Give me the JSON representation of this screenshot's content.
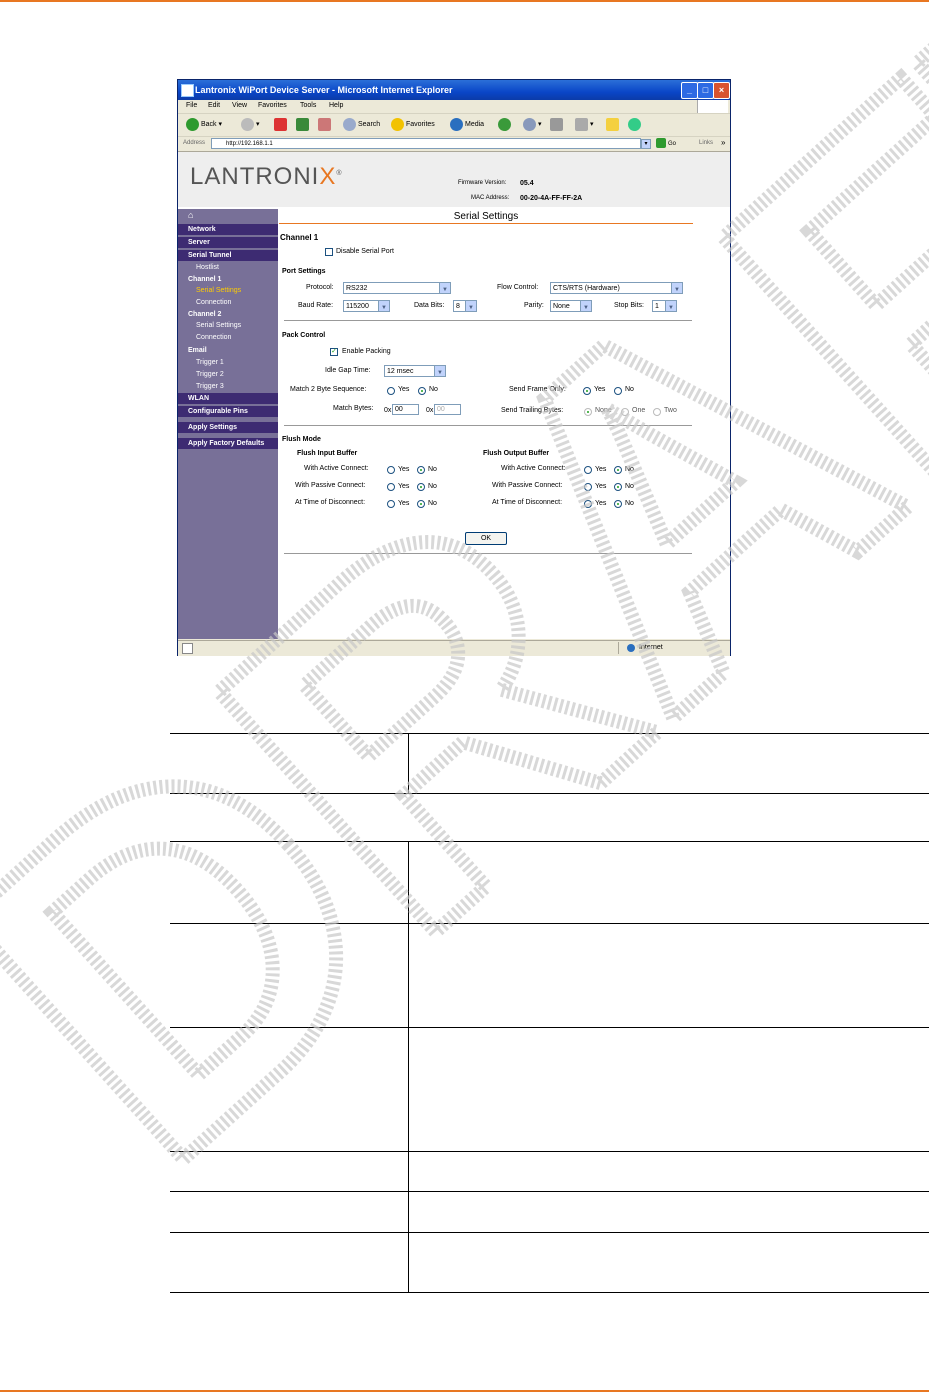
{
  "browser": {
    "title": "Lantronix WiPort Device Server - Microsoft Internet Explorer",
    "menu": [
      "File",
      "Edit",
      "View",
      "Favorites",
      "Tools",
      "Help"
    ],
    "toolbar": {
      "back": "Back",
      "search": "Search",
      "favorites": "Favorites",
      "media": "Media"
    },
    "address_label": "Address",
    "address_value": "http://192.168.1.1",
    "go": "Go",
    "links": "Links",
    "status_zone": "Internet"
  },
  "header": {
    "logo_text": "LANTRONI",
    "logo_x": "X",
    "logo_reg": "®",
    "firmware_label": "Firmware Version:",
    "firmware_value": "05.4",
    "mac_label": "MAC Address:",
    "mac_value": "00-20-4A-FF-FF-2A"
  },
  "sidebar": {
    "network": "Network",
    "server": "Server",
    "serial_tunnel": "Serial Tunnel",
    "hostlist": "Hostlist",
    "channel1": "Channel 1",
    "serial_settings1": "Serial Settings",
    "connection1": "Connection",
    "channel2": "Channel 2",
    "serial_settings2": "Serial Settings",
    "connection2": "Connection",
    "email": "Email",
    "trigger1": "Trigger 1",
    "trigger2": "Trigger 2",
    "trigger3": "Trigger 3",
    "wlan": "WLAN",
    "configurable_pins": "Configurable Pins",
    "apply_settings": "Apply Settings",
    "apply_factory": "Apply Factory Defaults"
  },
  "form": {
    "page_title": "Serial Settings",
    "channel_heading": "Channel 1",
    "disable_serial": "Disable Serial Port",
    "port_settings": "Port Settings",
    "protocol_label": "Protocol:",
    "protocol_value": "RS232",
    "flow_label": "Flow Control:",
    "flow_value": "CTS/RTS (Hardware)",
    "baud_label": "Baud Rate:",
    "baud_value": "115200",
    "databits_label": "Data Bits:",
    "databits_value": "8",
    "parity_label": "Parity:",
    "parity_value": "None",
    "stopbits_label": "Stop Bits:",
    "stopbits_value": "1",
    "pack_control": "Pack Control",
    "enable_packing": "Enable Packing",
    "idle_gap_label": "Idle Gap Time:",
    "idle_gap_value": "12 msec",
    "match2_label": "Match 2 Byte Sequence:",
    "send_frame_label": "Send Frame Only:",
    "match_bytes_label": "Match Bytes:",
    "hex_prefix": "0x",
    "match_byte1": "00",
    "match_byte2": "00",
    "send_trailing_label": "Send Trailing Bytes:",
    "none": "None",
    "one": "One",
    "two": "Two",
    "yes": "Yes",
    "no": "No",
    "flush_mode": "Flush Mode",
    "flush_input": "Flush Input Buffer",
    "flush_output": "Flush Output Buffer",
    "active_connect": "With Active Connect:",
    "passive_connect": "With Passive Connect:",
    "time_disconnect": "At Time of Disconnect:",
    "ok": "OK"
  },
  "watermark": "DRAFT",
  "colors": {
    "accent": "#e87722",
    "nav_dark": "#3d2b72",
    "nav_bg": "#787098"
  }
}
